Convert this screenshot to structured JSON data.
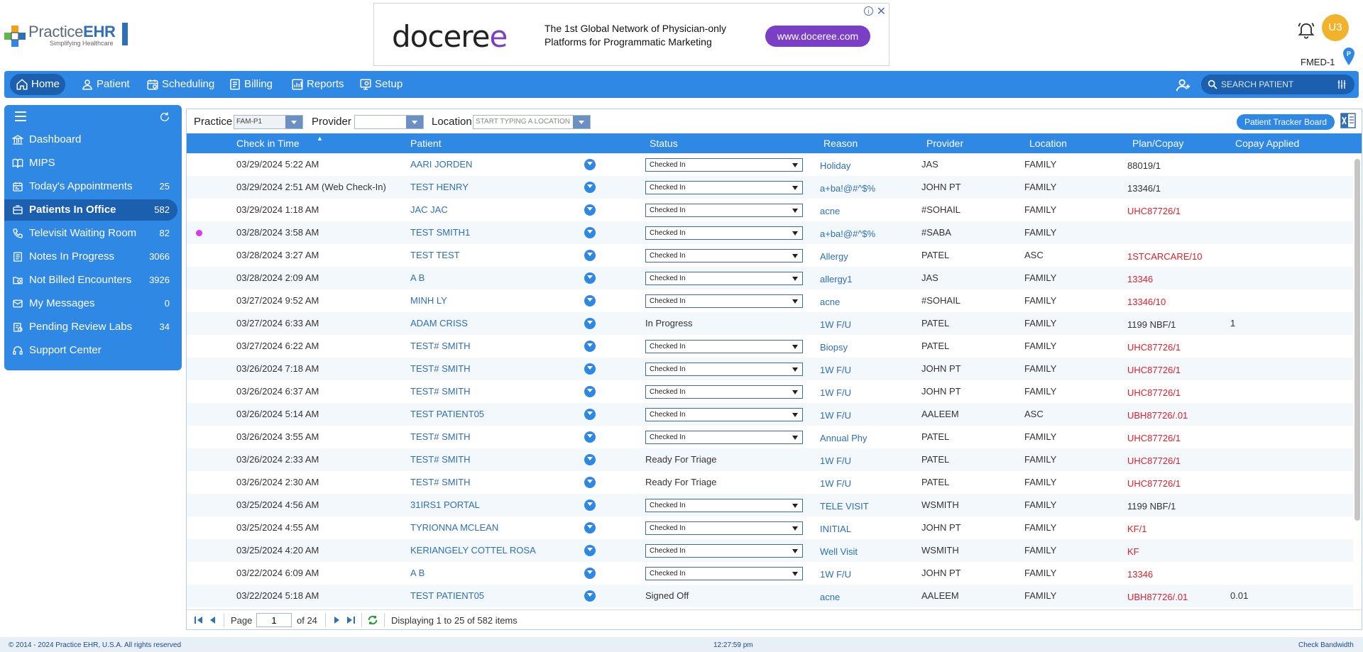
{
  "header": {
    "logo_text_a": "Practice",
    "logo_text_b": "EHR",
    "logo_tagline": "Simplifying Healthcare",
    "ad": {
      "brand_a": "docere",
      "brand_b": "e",
      "line1": "The 1st Global Network of Physician-only",
      "line2": "Platforms for Programmatic Marketing",
      "button": "www.doceree.com",
      "info": "i",
      "close": "✕"
    },
    "user_initials": "U3",
    "facility": "FMED-1"
  },
  "nav": {
    "items": [
      {
        "label": "Home",
        "icon": "home-icon"
      },
      {
        "label": "Patient",
        "icon": "user-icon"
      },
      {
        "label": "Scheduling",
        "icon": "calendar-icon"
      },
      {
        "label": "Billing",
        "icon": "billing-icon"
      },
      {
        "label": "Reports",
        "icon": "reports-icon"
      },
      {
        "label": "Setup",
        "icon": "setup-icon"
      }
    ],
    "search_placeholder": "SEARCH PATIENT"
  },
  "sidebar": {
    "items": [
      {
        "label": "Dashboard",
        "count": ""
      },
      {
        "label": "MIPS",
        "count": ""
      },
      {
        "label": "Today's Appointments",
        "count": "25"
      },
      {
        "label": "Patients In Office",
        "count": "582"
      },
      {
        "label": "Televisit Waiting Room",
        "count": "82"
      },
      {
        "label": "Notes In Progress",
        "count": "3066"
      },
      {
        "label": "Not Billed Encounters",
        "count": "3926"
      },
      {
        "label": "My Messages",
        "count": "0"
      },
      {
        "label": "Pending Review Labs",
        "count": "34"
      },
      {
        "label": "Support Center",
        "count": ""
      }
    ]
  },
  "filters": {
    "practice_label": "Practice",
    "practice_value": "FAM-P1",
    "provider_label": "Provider",
    "provider_value": "",
    "location_label": "Location",
    "location_placeholder": "START TYPING A LOCATION",
    "tracker_button": "Patient Tracker Board"
  },
  "table": {
    "headers": {
      "checkin": "Check in Time",
      "patient": "Patient",
      "status": "Status",
      "reason": "Reason",
      "provider": "Provider",
      "location": "Location",
      "plan": "Plan/Copay",
      "copay": "Copay Applied"
    },
    "rows": [
      {
        "time": "03/29/2024 5:22 AM",
        "patient": "AARI JORDEN",
        "status": "Checked In",
        "dropdown": true,
        "reason": "Holiday",
        "provider": "JAS",
        "location": "FAMILY",
        "plan": "88019/1",
        "plan_red": false,
        "copay": "",
        "dot": false
      },
      {
        "time": "03/29/2024 2:51 AM (Web Check-In)",
        "patient": "TEST HENRY",
        "status": "Checked In",
        "dropdown": true,
        "reason": "a+ba!@#^$%",
        "provider": "JOHN PT",
        "location": "FAMILY",
        "plan": "13346/1",
        "plan_red": false,
        "copay": "",
        "dot": false
      },
      {
        "time": "03/29/2024 1:18 AM",
        "patient": "JAC JAC",
        "status": "Checked In",
        "dropdown": true,
        "reason": "acne",
        "provider": "#SOHAIL",
        "location": "FAMILY",
        "plan": "UHC87726/1",
        "plan_red": true,
        "copay": "",
        "dot": false
      },
      {
        "time": "03/28/2024 3:58 AM",
        "patient": "TEST SMITH1",
        "status": "Checked In",
        "dropdown": true,
        "reason": "a+ba!@#^$%",
        "provider": "#SABA",
        "location": "FAMILY",
        "plan": "",
        "plan_red": false,
        "copay": "",
        "dot": true
      },
      {
        "time": "03/28/2024 3:27 AM",
        "patient": "TEST TEST",
        "status": "Checked In",
        "dropdown": true,
        "reason": "Allergy",
        "provider": "PATEL",
        "location": "ASC",
        "plan": "1STCARCARE/10",
        "plan_red": true,
        "copay": "",
        "dot": false
      },
      {
        "time": "03/28/2024 2:09 AM",
        "patient": "A B",
        "status": "Checked In",
        "dropdown": true,
        "reason": "allergy1",
        "provider": "JAS",
        "location": "FAMILY",
        "plan": "13346",
        "plan_red": true,
        "copay": "",
        "dot": false
      },
      {
        "time": "03/27/2024 9:52 AM",
        "patient": "MINH LY",
        "status": "Checked In",
        "dropdown": true,
        "reason": "acne",
        "provider": "#SOHAIL",
        "location": "FAMILY",
        "plan": "13346/10",
        "plan_red": true,
        "copay": "",
        "dot": false
      },
      {
        "time": "03/27/2024 6:33 AM",
        "patient": "ADAM CRISS",
        "status": "In Progress",
        "dropdown": false,
        "reason": "1W F/U",
        "provider": "PATEL",
        "location": "FAMILY",
        "plan": "1199 NBF/1",
        "plan_red": false,
        "copay": "1",
        "dot": false
      },
      {
        "time": "03/27/2024 6:22 AM",
        "patient": "TEST# SMITH",
        "status": "Checked In",
        "dropdown": true,
        "reason": "Biopsy",
        "provider": "PATEL",
        "location": "FAMILY",
        "plan": "UHC87726/1",
        "plan_red": true,
        "copay": "",
        "dot": false
      },
      {
        "time": "03/26/2024 7:18 AM",
        "patient": "TEST# SMITH",
        "status": "Checked In",
        "dropdown": true,
        "reason": "1W F/U",
        "provider": "JOHN PT",
        "location": "FAMILY",
        "plan": "UHC87726/1",
        "plan_red": true,
        "copay": "",
        "dot": false
      },
      {
        "time": "03/26/2024 6:37 AM",
        "patient": "TEST# SMITH",
        "status": "Checked In",
        "dropdown": true,
        "reason": "1W F/U",
        "provider": "JOHN PT",
        "location": "FAMILY",
        "plan": "UHC87726/1",
        "plan_red": true,
        "copay": "",
        "dot": false
      },
      {
        "time": "03/26/2024 5:14 AM",
        "patient": "TEST PATIENT05",
        "status": "Checked In",
        "dropdown": true,
        "reason": "1W F/U",
        "provider": "AALEEM",
        "location": "ASC",
        "plan": "UBH87726/.01",
        "plan_red": true,
        "copay": "",
        "dot": false
      },
      {
        "time": "03/26/2024 3:55 AM",
        "patient": "TEST# SMITH",
        "status": "Checked In",
        "dropdown": true,
        "reason": "Annual Phy",
        "provider": "PATEL",
        "location": "FAMILY",
        "plan": "UHC87726/1",
        "plan_red": true,
        "copay": "",
        "dot": false
      },
      {
        "time": "03/26/2024 2:33 AM",
        "patient": "TEST# SMITH",
        "status": "Ready For Triage",
        "dropdown": false,
        "reason": "1W F/U",
        "provider": "PATEL",
        "location": "FAMILY",
        "plan": "UHC87726/1",
        "plan_red": true,
        "copay": "",
        "dot": false
      },
      {
        "time": "03/26/2024 2:30 AM",
        "patient": "TEST# SMITH",
        "status": "Ready For Triage",
        "dropdown": false,
        "reason": "1W F/U",
        "provider": "PATEL",
        "location": "FAMILY",
        "plan": "UHC87726/1",
        "plan_red": true,
        "copay": "",
        "dot": false
      },
      {
        "time": "03/25/2024 4:56 AM",
        "patient": "31IRS1 PORTAL",
        "status": "Checked In",
        "dropdown": true,
        "reason": "TELE VISIT",
        "provider": "WSMITH",
        "location": "FAMILY",
        "plan": "1199 NBF/1",
        "plan_red": false,
        "copay": "",
        "dot": false
      },
      {
        "time": "03/25/2024 4:55 AM",
        "patient": "TYRIONNA MCLEAN",
        "status": "Checked In",
        "dropdown": true,
        "reason": "INITIAL",
        "provider": "JOHN PT",
        "location": "FAMILY",
        "plan": "KF/1",
        "plan_red": true,
        "copay": "",
        "dot": false
      },
      {
        "time": "03/25/2024 4:20 AM",
        "patient": "KERIANGELY COTTEL ROSA",
        "status": "Checked In",
        "dropdown": true,
        "reason": "Well Visit",
        "provider": "WSMITH",
        "location": "FAMILY",
        "plan": "KF",
        "plan_red": true,
        "copay": "",
        "dot": false
      },
      {
        "time": "03/22/2024 6:09 AM",
        "patient": "A B",
        "status": "Checked In",
        "dropdown": true,
        "reason": "1W F/U",
        "provider": "JOHN PT",
        "location": "FAMILY",
        "plan": "13346",
        "plan_red": true,
        "copay": "",
        "dot": false
      },
      {
        "time": "03/22/2024 5:18 AM",
        "patient": "TEST PATIENT05",
        "status": "Signed Off",
        "dropdown": false,
        "reason": "acne",
        "provider": "AALEEM",
        "location": "FAMILY",
        "plan": "UBH87726/.01",
        "plan_red": true,
        "copay": "0.01",
        "dot": false
      }
    ]
  },
  "pager": {
    "page_label": "Page",
    "page_value": "1",
    "of_label": "of 24",
    "display": "Displaying 1 to 25 of 582 items"
  },
  "footer": {
    "copyright": "© 2014 - 2024 Practice EHR, U.S.A. All rights reserved",
    "time": "12:27:59 pm",
    "bandwidth": "Check Bandwidth"
  },
  "colors": {
    "primary": "#2e88e4",
    "primary_dark": "#1b5fae",
    "link": "#2e6fb5",
    "alert_red": "#e0202a",
    "avatar": "#f1b32c",
    "ad_purple": "#7b3fc6"
  }
}
